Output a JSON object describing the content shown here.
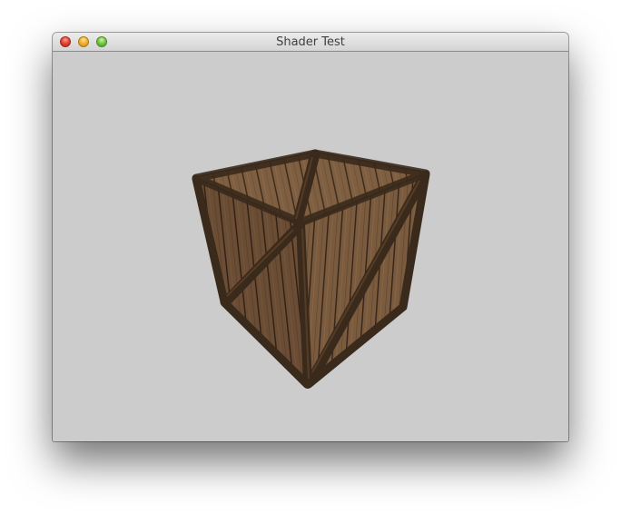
{
  "window": {
    "title": "Shader Test"
  },
  "traffic_lights": {
    "close_color": "#e5453a",
    "minimize_color": "#f2b230",
    "zoom_color": "#7ac74a"
  },
  "viewport": {
    "background_color": "#cccccc",
    "object": "crate"
  },
  "colors": {
    "wood_light": "#8a6a4a",
    "wood_dark": "#4e3624",
    "frame": "#3a2a1c"
  }
}
